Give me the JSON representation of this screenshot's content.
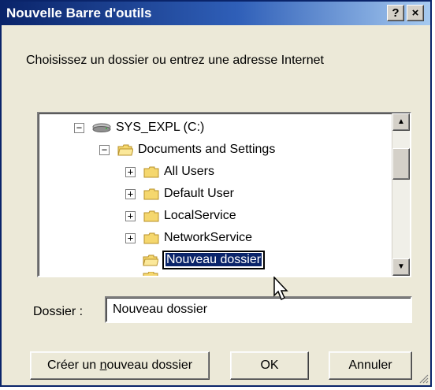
{
  "window": {
    "title": "Nouvelle Barre d'outils",
    "help_button": "?",
    "close_button": "×"
  },
  "instruction": "Choisissez un dossier ou entrez une adresse Internet",
  "tree": {
    "items": [
      {
        "label": "SYS_EXPL (C:)",
        "icon": "drive-icon",
        "expander": "−"
      },
      {
        "label": "Documents and Settings",
        "icon": "folder-open-icon",
        "expander": "−"
      },
      {
        "label": "All Users",
        "icon": "folder-icon",
        "expander": "+"
      },
      {
        "label": "Default User",
        "icon": "folder-icon",
        "expander": "+"
      },
      {
        "label": "LocalService",
        "icon": "folder-icon",
        "expander": "+"
      },
      {
        "label": "NetworkService",
        "icon": "folder-icon",
        "expander": "+"
      },
      {
        "label": "Nouveau dossier",
        "icon": "folder-open-icon",
        "editing": true
      }
    ],
    "scroll_up": "▲",
    "scroll_down": "▼"
  },
  "dossier": {
    "label": "Dossier :",
    "value": "Nouveau dossier"
  },
  "buttons": {
    "create_prefix": "Créer un ",
    "create_accel": "n",
    "create_suffix": "ouveau dossier",
    "ok": "OK",
    "cancel": "Annuler"
  },
  "colors": {
    "title_bar": "#0a246a",
    "dialog_bg": "#ece9d8",
    "selection": "#0a246a",
    "folder": "#f5d76e"
  }
}
